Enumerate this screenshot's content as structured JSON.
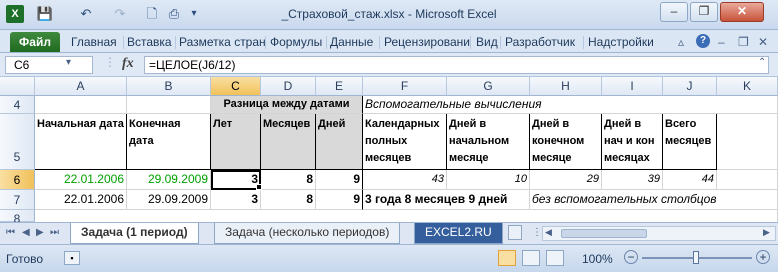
{
  "window": {
    "title": "_Страховой_стаж.xlsx  -  Microsoft Excel",
    "qat": {
      "save": "💾",
      "undo": "↶",
      "redo": "↷",
      "preview": "🗋",
      "print": "⎙",
      "more": "▾"
    },
    "controls": {
      "minimize": "–",
      "restore": "❐",
      "close": "✕"
    }
  },
  "ribbon": {
    "file_tab": "Файл",
    "tabs": [
      "Главная",
      "Вставка",
      "Разметка стран",
      "Формулы",
      "Данные",
      "Рецензировани",
      "Вид",
      "Разработчик",
      "Надстройки"
    ],
    "help": "?",
    "minimize": "▵",
    "restore": "❐",
    "close": "✕"
  },
  "formula_bar": {
    "name_box": "C6",
    "name_arrow": "▾",
    "fx": "fx",
    "formula": "=ЦЕЛОЕ(J6/12)",
    "expand": "⌃"
  },
  "grid": {
    "columns": [
      "A",
      "B",
      "C",
      "D",
      "E",
      "F",
      "G",
      "H",
      "I",
      "J",
      "K"
    ],
    "selected_column": "C",
    "rows": [
      "4",
      "5",
      "6",
      "7",
      "8"
    ],
    "selected_row": "6",
    "row4": {
      "C": "Разница между датами",
      "F": "Вспомогательные вычисления"
    },
    "row5": {
      "A": "Начальная дата",
      "B": "Конечная дата",
      "C": "Лет",
      "D": "Месяцев",
      "E": "Дней",
      "F": "Календарных полных месяцев",
      "G": "Дней в начальном месяце",
      "H": "Дней в конечном месяце",
      "I": "Дней в нач и кон месяцах",
      "J": "Всего месяцев"
    },
    "row6": {
      "A": "22.01.2006",
      "B": "29.09.2009",
      "C": "3",
      "D": "8",
      "E": "9",
      "F": "43",
      "G": "10",
      "H": "29",
      "I": "39",
      "J": "44"
    },
    "row7": {
      "A": "22.01.2006",
      "B": "29.09.2009",
      "C": "3",
      "D": "8",
      "E": "9",
      "F": "3 года 8 месяцев 9 дней",
      "H": "без вспомогательных столбцов"
    },
    "colors": {
      "date_green": "#00a000",
      "header_gray": "#d9d9d9",
      "selection": "#f1c15a"
    }
  },
  "sheets": {
    "tabs": [
      "Задача (1 период)",
      "Задача (несколько периодов)",
      "EXCEL2.RU"
    ],
    "active": "Задача (1 период)",
    "nav": [
      "⏮",
      "◀",
      "▶",
      "⏭"
    ]
  },
  "status": {
    "text": "Готово",
    "zoom": "100%",
    "zoom_out": "−",
    "zoom_in": "+",
    "zoom_level": 1.0
  }
}
